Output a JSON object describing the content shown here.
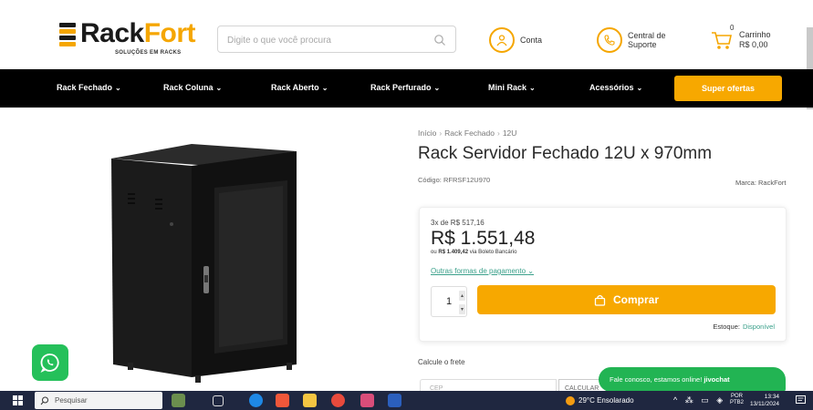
{
  "header": {
    "logo_part1": "Rack",
    "logo_part2": "Fort",
    "logo_tagline": "SOLUÇÕES EM RACKS",
    "search_placeholder": "Digite o que você procura",
    "account_label": "Conta",
    "support_line1": "Central de",
    "support_line2": "Suporte",
    "cart_count": "0",
    "cart_label": "Carrinho",
    "cart_total": "R$ 0,00"
  },
  "nav": {
    "items": [
      {
        "label": "Rack Fechado"
      },
      {
        "label": "Rack Coluna"
      },
      {
        "label": "Rack Aberto"
      },
      {
        "label": "Rack Perfurado"
      },
      {
        "label": "Mini Rack"
      },
      {
        "label": "Acessórios"
      }
    ],
    "offers_label": "Super ofertas"
  },
  "product": {
    "breadcrumb": [
      "Início",
      "Rack Fechado",
      "12U"
    ],
    "title": "Rack Servidor Fechado 12U x 970mm",
    "sku_label": "Código:",
    "sku": "RFRSF12U970",
    "brand_label": "Marca:",
    "brand": "RackFort",
    "installments": "3x de R$ 517,16",
    "price": "R$ 1.551,48",
    "boleto_prefix": "ou",
    "boleto_price": "R$ 1.409,42",
    "boleto_suffix": "via Boleto Bancário",
    "payment_link": "Outras formas de pagamento",
    "quantity": "1",
    "buy_label": "Comprar",
    "stock_label": "Estoque:",
    "stock_value": "Disponível",
    "shipping_label": "Calcule o frete",
    "cep_placeholder": "CEP",
    "calc_label": "CALCULAR"
  },
  "chat": {
    "text": "Fale conosco, estamos online!",
    "brand": "jivochat"
  },
  "taskbar": {
    "search_label": "Pesquisar",
    "weather": "29°C  Ensolarado",
    "lang_line1": "POR",
    "lang_line2": "PTB2",
    "time": "13:34",
    "date": "13/11/2024"
  },
  "colors": {
    "accent": "#f7a800",
    "nav_bg": "#000000",
    "link": "#3aa08a",
    "whatsapp": "#25c05a",
    "taskbar": "#1f2740"
  }
}
